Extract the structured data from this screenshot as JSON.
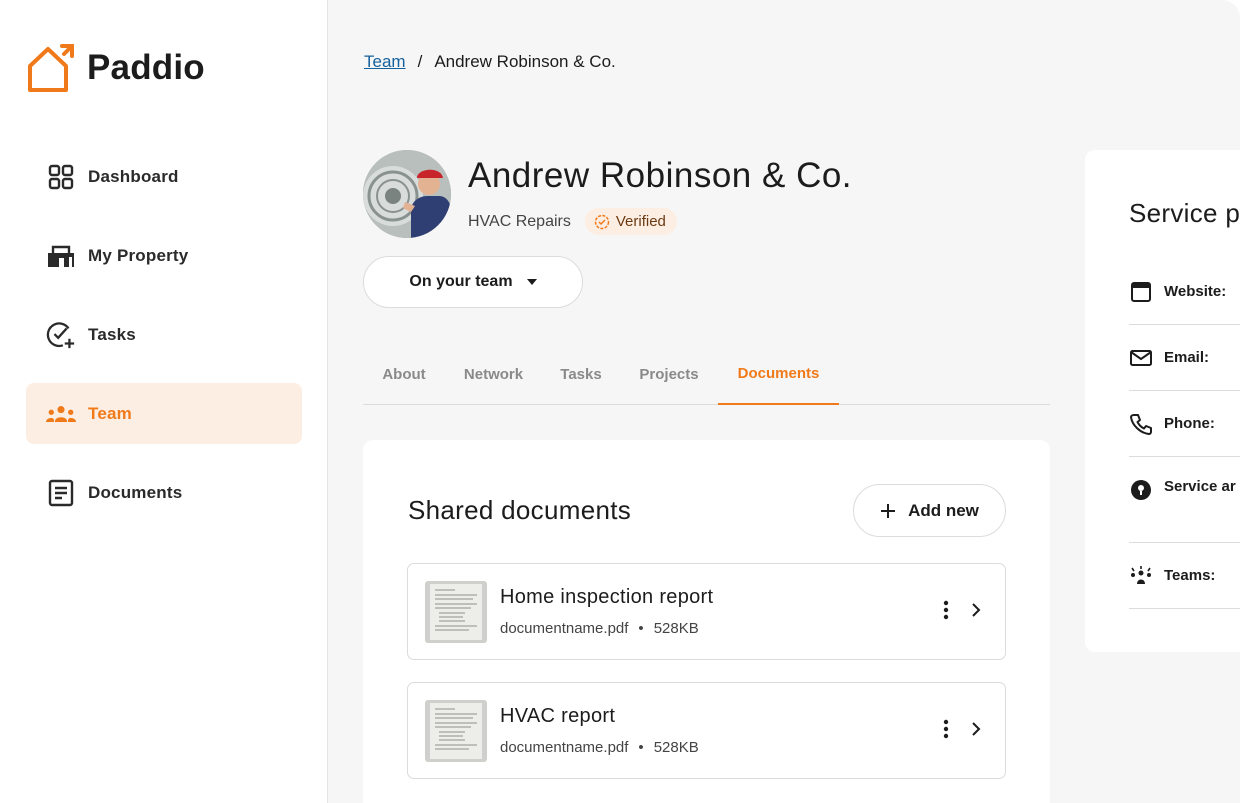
{
  "app": {
    "name": "Paddio"
  },
  "colors": {
    "accent": "#f07a1a",
    "active_bg": "#fdeee3",
    "link": "#16619c"
  },
  "sidebar": {
    "items": [
      {
        "label": "Dashboard",
        "icon": "grid-icon"
      },
      {
        "label": "My Property",
        "icon": "house-icon"
      },
      {
        "label": "Tasks",
        "icon": "task-check-icon"
      },
      {
        "label": "Team",
        "icon": "team-icon",
        "active": true
      },
      {
        "label": "Documents",
        "icon": "document-icon"
      }
    ]
  },
  "breadcrumb": {
    "link": "Team",
    "separator": "/",
    "current": "Andrew Robinson & Co."
  },
  "profile": {
    "name": "Andrew Robinson & Co.",
    "category": "HVAC Repairs",
    "badge": "Verified",
    "team_status": "On your team"
  },
  "tabs": [
    {
      "label": "About"
    },
    {
      "label": "Network"
    },
    {
      "label": "Tasks"
    },
    {
      "label": "Projects"
    },
    {
      "label": "Documents",
      "active": true
    }
  ],
  "documents": {
    "title": "Shared documents",
    "add_label": "Add new",
    "items": [
      {
        "title": "Home inspection report",
        "filename": "documentname.pdf",
        "size": "528KB"
      },
      {
        "title": "HVAC report",
        "filename": "documentname.pdf",
        "size": "528KB"
      }
    ]
  },
  "service": {
    "title": "Service p",
    "rows": [
      {
        "label": "Website:",
        "icon": "browser-window-icon"
      },
      {
        "label": "Email:",
        "icon": "mail-icon"
      },
      {
        "label": "Phone:",
        "icon": "phone-icon"
      },
      {
        "label": "Service ar",
        "icon": "location-pin-icon"
      },
      {
        "label": "Teams:",
        "icon": "teams-icon"
      }
    ]
  }
}
